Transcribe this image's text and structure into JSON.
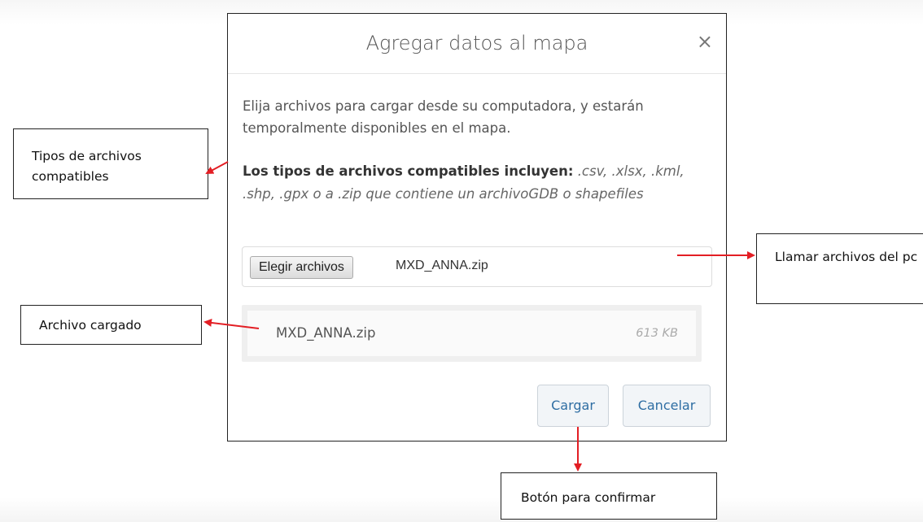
{
  "dialog": {
    "title": "Agregar datos al mapa",
    "close_symbol": "×",
    "intro_text": "Elija archivos para cargar desde su computadora, y estarán temporalmente disponibles en el mapa.",
    "formats_label": "Los tipos de archivos compatibles incluyen:",
    "formats_list": ".csv, .xlsx, .kml, .shp, .gpx o a .zip que contiene un archivoGDB o shapefiles",
    "choose_button_label": "Elegir archivos",
    "chosen_file_name": "MXD_ANNA.zip",
    "uploaded_file": {
      "name": "MXD_ANNA.zip",
      "size": "613 KB"
    },
    "upload_button_label": "Cargar",
    "cancel_button_label": "Cancelar"
  },
  "annotations": {
    "file_types": "Tipos de archivos compatibles",
    "loaded_file": "Archivo cargado",
    "call_files": "Llamar archivos del pc",
    "confirm_button": "Botón para confirmar"
  },
  "colors": {
    "arrow": "#e31e24",
    "button_text": "#2f6ea3",
    "callout_border": "#222222"
  }
}
